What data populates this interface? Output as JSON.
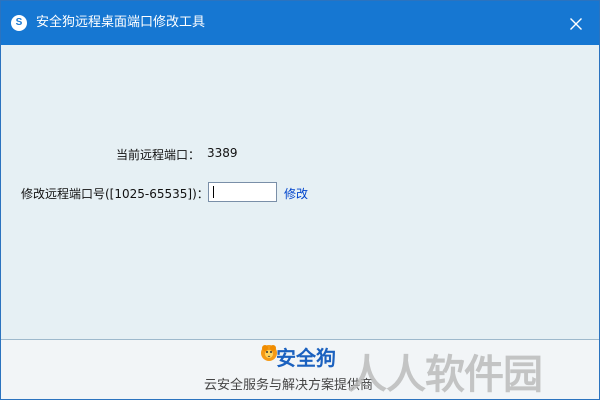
{
  "window": {
    "title": "安全狗远程桌面端口修改工具",
    "app_icon_letter": "S"
  },
  "icons": {
    "app": "security-dog-logo-icon",
    "close": "close-icon",
    "brand": "security-dog-brand-icon"
  },
  "colors": {
    "titlebar": "#1677d2",
    "content_background": "#e6f0f4",
    "footer_background": "#f2f5f7",
    "link": "#0044cc",
    "brand": "#1b61bf",
    "watermark": "#b8b8b8"
  },
  "main": {
    "current_port_label": "当前远程端口：",
    "current_port_value": "3389",
    "new_port_label": "修改远程端口号([1025-65535])：",
    "new_port_value": "",
    "new_port_placeholder": "",
    "modify_link": "修改"
  },
  "footer": {
    "brand_name": "安全狗",
    "slogan": "云安全服务与解决方案提供商",
    "watermark": "人人软件园"
  }
}
